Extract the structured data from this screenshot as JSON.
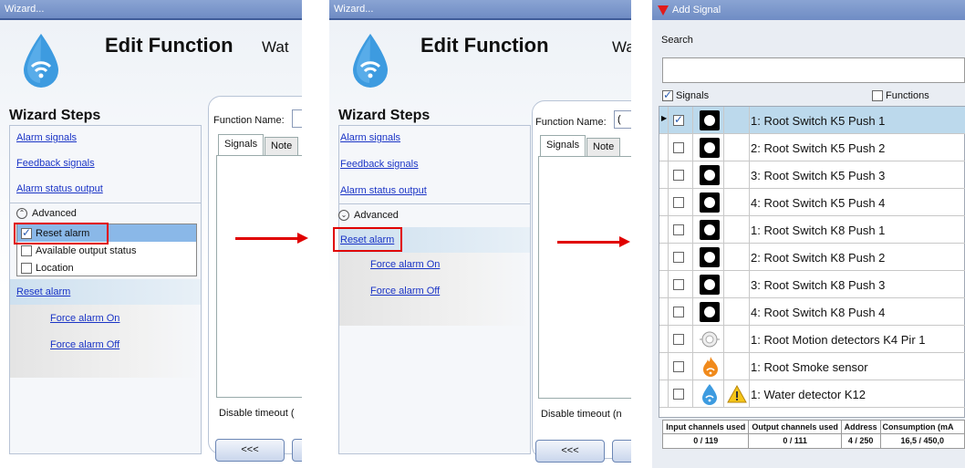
{
  "panel1": {
    "title": "Wizard...",
    "edit_title": "Edit Function",
    "edit_sub": "Wat",
    "steps_title": "Wizard Steps",
    "steps": [
      "Alarm signals",
      "Feedback signals",
      "Alarm status output"
    ],
    "advanced_label": "Advanced",
    "advanced_options": [
      {
        "label": "Reset alarm",
        "checked": true
      },
      {
        "label": "Available output status",
        "checked": false
      },
      {
        "label": "Location",
        "checked": false
      }
    ],
    "reset_link": "Reset alarm",
    "force_on": "Force alarm On",
    "force_off": "Force alarm Off",
    "function_name_label": "Function Name:",
    "tab_signals": "Signals",
    "tab_notes": "Note",
    "disable_timeout": "Disable timeout (",
    "back_button": "<<<"
  },
  "panel2": {
    "title": "Wizard...",
    "edit_title": "Edit Function",
    "edit_sub": "Wat",
    "steps_title": "Wizard Steps",
    "steps": [
      "Alarm signals",
      "Feedback signals",
      "Alarm status output"
    ],
    "advanced_label": "Advanced",
    "reset_link": "Reset alarm",
    "force_on": "Force alarm On",
    "force_off": "Force alarm Off",
    "function_name_label": "Function Name:",
    "function_name_value": "(",
    "tab_signals": "Signals",
    "tab_notes": "Note",
    "disable_timeout": "Disable timeout (n",
    "back_button": "<<<"
  },
  "panel3": {
    "title": "Add Signal",
    "search_label": "Search",
    "filter_signals": "Signals",
    "filter_functions": "Functions",
    "rows": [
      {
        "label": "1: Root Switch K5 Push 1",
        "checked": true,
        "icon": "switch-icon"
      },
      {
        "label": "2: Root Switch K5 Push 2",
        "checked": false,
        "icon": "switch-icon"
      },
      {
        "label": "3: Root Switch K5 Push 3",
        "checked": false,
        "icon": "switch-icon"
      },
      {
        "label": "4: Root Switch K5 Push 4",
        "checked": false,
        "icon": "switch-icon"
      },
      {
        "label": "1: Root Switch K8 Push 1",
        "checked": false,
        "icon": "switch-icon"
      },
      {
        "label": "2: Root Switch K8 Push 2",
        "checked": false,
        "icon": "switch-icon"
      },
      {
        "label": "3: Root Switch K8 Push 3",
        "checked": false,
        "icon": "switch-icon"
      },
      {
        "label": "4: Root Switch K8 Push 4",
        "checked": false,
        "icon": "switch-icon"
      },
      {
        "label": "1: Root Motion detectors K4 Pir 1",
        "checked": false,
        "icon": "motion-icon"
      },
      {
        "label": "1: Root Smoke sensor",
        "checked": false,
        "icon": "smoke-icon"
      },
      {
        "label": "1: Water detector K12",
        "checked": false,
        "icon": "water-icon"
      }
    ],
    "footer_headers": [
      "Input channels used",
      "Output channels used",
      "Address",
      "Consumption (mA"
    ],
    "footer_values": [
      "0 / 119",
      "0 / 111",
      "4 / 250",
      "16,5 / 450,0"
    ]
  },
  "colors": {
    "accent_red": "#e00000",
    "link_blue": "#1a34c6",
    "title_bar": "#7a96cc",
    "selection": "#bcd9ec"
  }
}
